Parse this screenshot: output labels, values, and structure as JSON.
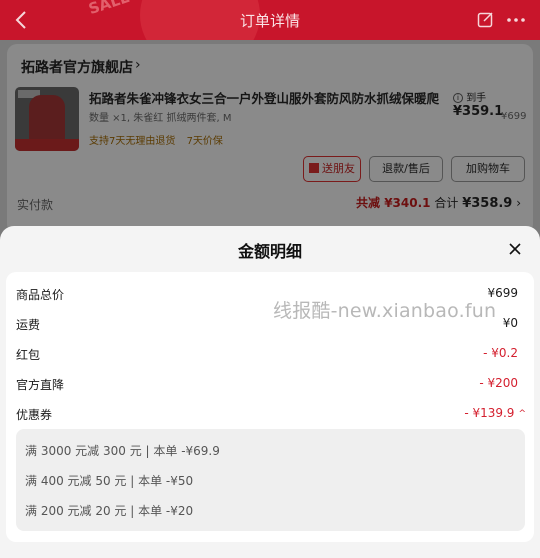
{
  "header": {
    "title": "订单详情",
    "deco_text": "SALE"
  },
  "store": {
    "name": "拓路者官方旗舰店",
    "arrow": "›",
    "product": {
      "title": "拓路者朱雀冲锋衣女三合一户外登山服外套防风防水抓绒保暖爬...",
      "spec": "数量 ×1, 朱雀红 抓绒两件套, M",
      "tags": [
        "支持7天无理由退货",
        "7天价保"
      ],
      "price_prefix": "到手",
      "price": "¥359.1",
      "original_price": "¥699"
    },
    "buttons": {
      "gift": "送朋友",
      "refund": "退款/售后",
      "cart": "加购物车"
    },
    "paid_label": "实付款",
    "discount_text": "共减 ¥340.1",
    "total_prefix": "合计 ",
    "total": "¥358.9",
    "total_arrow": "›"
  },
  "sheet": {
    "title": "金额明细",
    "rows": [
      {
        "label": "商品总价",
        "value": "¥699"
      },
      {
        "label": "运费",
        "value": "¥0"
      },
      {
        "label": "红包",
        "value": "- ¥0.2"
      },
      {
        "label": "官方直降",
        "value": "- ¥200"
      },
      {
        "label": "优惠券",
        "value": "- ¥139.9"
      }
    ],
    "coupons": [
      "满 3000 元减 300 元 | 本单 -¥69.9",
      "满 400 元减 50 元 | 本单 -¥50",
      "满 200 元减 20 元 | 本单 -¥20"
    ],
    "watermark": "线报酷-new.xianbao.fun"
  },
  "colors": {
    "header_red": "#c8152b",
    "discount_red": "#d41f2e"
  },
  "icons": [
    "back-icon",
    "share-icon",
    "more-icon",
    "info-icon",
    "gift-icon",
    "close-icon",
    "chevron-up-icon"
  ]
}
